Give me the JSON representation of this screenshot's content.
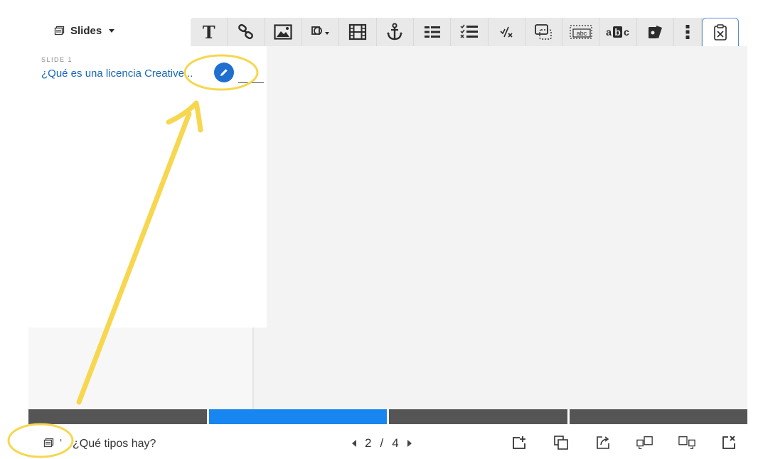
{
  "header": {
    "slides_menu_label": "Slides",
    "slides_menu_icon": "slides-stack-icon"
  },
  "toolbar": {
    "items": [
      {
        "name": "text-tool",
        "glyph": "T"
      },
      {
        "name": "link-tool"
      },
      {
        "name": "image-tool"
      },
      {
        "name": "shapes-tool"
      },
      {
        "name": "video-tool"
      },
      {
        "name": "anchor-tool"
      },
      {
        "name": "toggle-tool"
      },
      {
        "name": "checklist-tool"
      },
      {
        "name": "fraction-tool"
      },
      {
        "name": "hotspot-tool"
      },
      {
        "name": "fill-blanks-tool",
        "glyph": "abc"
      },
      {
        "name": "mark-words-tool",
        "glyph_a": "a",
        "glyph_b": "b",
        "glyph_c": "c"
      },
      {
        "name": "flashcards-tool"
      },
      {
        "name": "more-tool"
      },
      {
        "name": "paste-tool"
      }
    ],
    "selected": "paste-tool"
  },
  "left_panel": {
    "slide_label": "SLIDE 1",
    "slide_title": "¿Qué es una licencia Creative..."
  },
  "progress": {
    "segments": 4,
    "active_index": 1
  },
  "footer": {
    "current_title": "¿Qué tipos hay?",
    "tick": "'",
    "current_page": "2",
    "separator": "/",
    "total_pages": "4"
  },
  "colors": {
    "accent": "#1886f0",
    "link": "#1767b8",
    "annotation": "#f6d74f",
    "toolbar_bg": "#e9e9e9"
  }
}
